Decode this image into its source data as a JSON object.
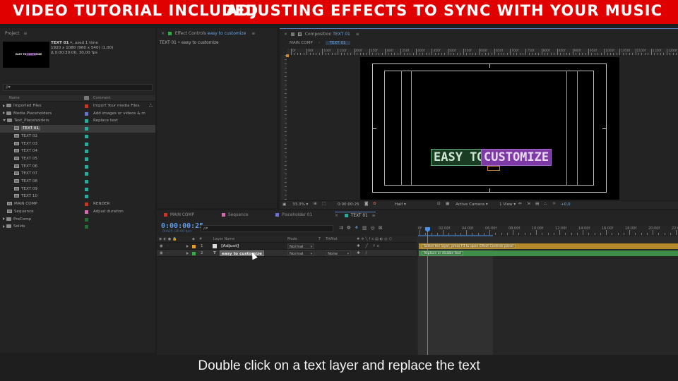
{
  "banner": {
    "left_text": "VIDEO TUTORIAL INCLUDED",
    "right_text": "ADJUSTING EFFECTS TO SYNC WITH YOUR MUSIC",
    "color": "#e00000"
  },
  "project_panel": {
    "tab_label": "Project",
    "preview": {
      "name": "TEXT 01",
      "used": ", used 1 time",
      "resolution": "1920 x 1080  (960 x 540) (1,00)",
      "duration": "Δ 0:00:30:00, 30,00 fps",
      "thumb_text": "EASY TO CUSTOMIZE"
    },
    "columns": {
      "name": "Name",
      "comment": "Comment"
    },
    "items": [
      {
        "name": "Imported Files",
        "comment": "Import Your media Files",
        "type": "folder",
        "indent": 0,
        "label_color": "#c0392b"
      },
      {
        "name": "Media Placeholders",
        "comment": "Add images or videos & m",
        "type": "folder",
        "indent": 0,
        "label_color": "#6b72c8"
      },
      {
        "name": "Text_Placeholders",
        "comment": "Replace text",
        "type": "folder-open",
        "indent": 0,
        "label_color": "#2fa89a"
      },
      {
        "name": "TEXT 01",
        "comment": "",
        "type": "comp",
        "indent": 1,
        "label_color": "#2fa89a",
        "selected": true
      },
      {
        "name": "TEXT 02",
        "comment": "",
        "type": "comp",
        "indent": 1,
        "label_color": "#2fa89a"
      },
      {
        "name": "TEXT 03",
        "comment": "",
        "type": "comp",
        "indent": 1,
        "label_color": "#2fa89a"
      },
      {
        "name": "TEXT 04",
        "comment": "",
        "type": "comp",
        "indent": 1,
        "label_color": "#2fa89a"
      },
      {
        "name": "TEXT 05",
        "comment": "",
        "type": "comp",
        "indent": 1,
        "label_color": "#2fa89a"
      },
      {
        "name": "TEXT 06",
        "comment": "",
        "type": "comp",
        "indent": 1,
        "label_color": "#2fa89a"
      },
      {
        "name": "TEXT 07",
        "comment": "",
        "type": "comp",
        "indent": 1,
        "label_color": "#2fa89a"
      },
      {
        "name": "TEXT 08",
        "comment": "",
        "type": "comp",
        "indent": 1,
        "label_color": "#2fa89a"
      },
      {
        "name": "TEXT 09",
        "comment": "",
        "type": "comp",
        "indent": 1,
        "label_color": "#2fa89a"
      },
      {
        "name": "TEXT 10",
        "comment": "",
        "type": "comp",
        "indent": 1,
        "label_color": "#2fa89a"
      },
      {
        "name": "MAIN COMP",
        "comment": "RENDER",
        "type": "comp",
        "indent": 0,
        "label_color": "#c0392b"
      },
      {
        "name": "Sequence",
        "comment": "Adjust duration",
        "type": "comp",
        "indent": 0,
        "label_color": "#d070b0"
      },
      {
        "name": "PreComp",
        "comment": "",
        "type": "folder",
        "indent": 0,
        "label_color": "#2a6a3a"
      },
      {
        "name": "Solids",
        "comment": "",
        "type": "folder",
        "indent": 0,
        "label_color": "#2a6a3a"
      }
    ]
  },
  "effect_controls": {
    "tab_prefix": "Effect Controls",
    "tab_layer": "easy to customize",
    "header": "TEXT 01 • easy to customize"
  },
  "composition_panel": {
    "tab_prefix": "Composition",
    "tab_comp": "TEXT 01",
    "breadcrumbs": [
      "MAIN COMP",
      "TEXT 01"
    ],
    "ruler_labels": [
      "0f",
      "00f",
      "100f",
      "150f",
      "200f",
      "250f",
      "300f",
      "350f",
      "400f",
      "450f",
      "500f",
      "550f",
      "600f",
      "650f",
      "700f",
      "750f",
      "800f",
      "850f",
      "900f",
      "950f",
      "1000f",
      "1050f",
      "1100f",
      "1150f",
      "1200f"
    ],
    "canvas_text_left": "EASY TO",
    "canvas_text_right": "CUSTOMIZE",
    "text_colors": {
      "left_bg": "#1f4a2a",
      "right_bg": "#7d3aa6",
      "left_border": "#5aa56a"
    },
    "bottom_bar": {
      "zoom": "33.3%",
      "timecode": "0:00:00:25",
      "resolution": "Half",
      "camera": "Active Camera",
      "view": "1 View",
      "exposure": "+0,0"
    }
  },
  "timeline": {
    "tabs": [
      {
        "label": "MAIN COMP",
        "color": "#c0392b"
      },
      {
        "label": "Sequence",
        "color": "#d070b0"
      },
      {
        "label": "Placeholder 01",
        "color": "#6b72c8"
      },
      {
        "label": "TEXT 01",
        "color": "#2fa89a",
        "active": true
      }
    ],
    "timecode": "0:00:00:25",
    "frame_info": "00025 (30.00 fps)",
    "search_placeholder": "ρ▾",
    "columns": {
      "layer_name": "Layer Name",
      "mode": "Mode",
      "t": "T",
      "trkmat": "TrkMat"
    },
    "layers": [
      {
        "index": "1",
        "name": "[Adjust]",
        "mode": "Normal",
        "trkmat": "",
        "color": "#e2a020",
        "bar_text": "Select the layer, press F3 to open Effect Controls panel",
        "bar_color": "#b38a2a"
      },
      {
        "index": "2",
        "name": "easy to customize",
        "mode": "Normal",
        "trkmat": "None",
        "color": "#3aa84a",
        "bar_text": "Replace or disable text",
        "bar_color": "#3f8f4a",
        "selected": true,
        "text_layer": "T"
      }
    ],
    "ruler": [
      "0f",
      "02:00f",
      "04:00f",
      "06:00f",
      "08:00f",
      "10:00f",
      "12:00f",
      "14:00f",
      "16:00f",
      "18:00f",
      "20:00f",
      "22:00f"
    ]
  },
  "caption": {
    "text": "Double click on a text layer and replace the text"
  }
}
